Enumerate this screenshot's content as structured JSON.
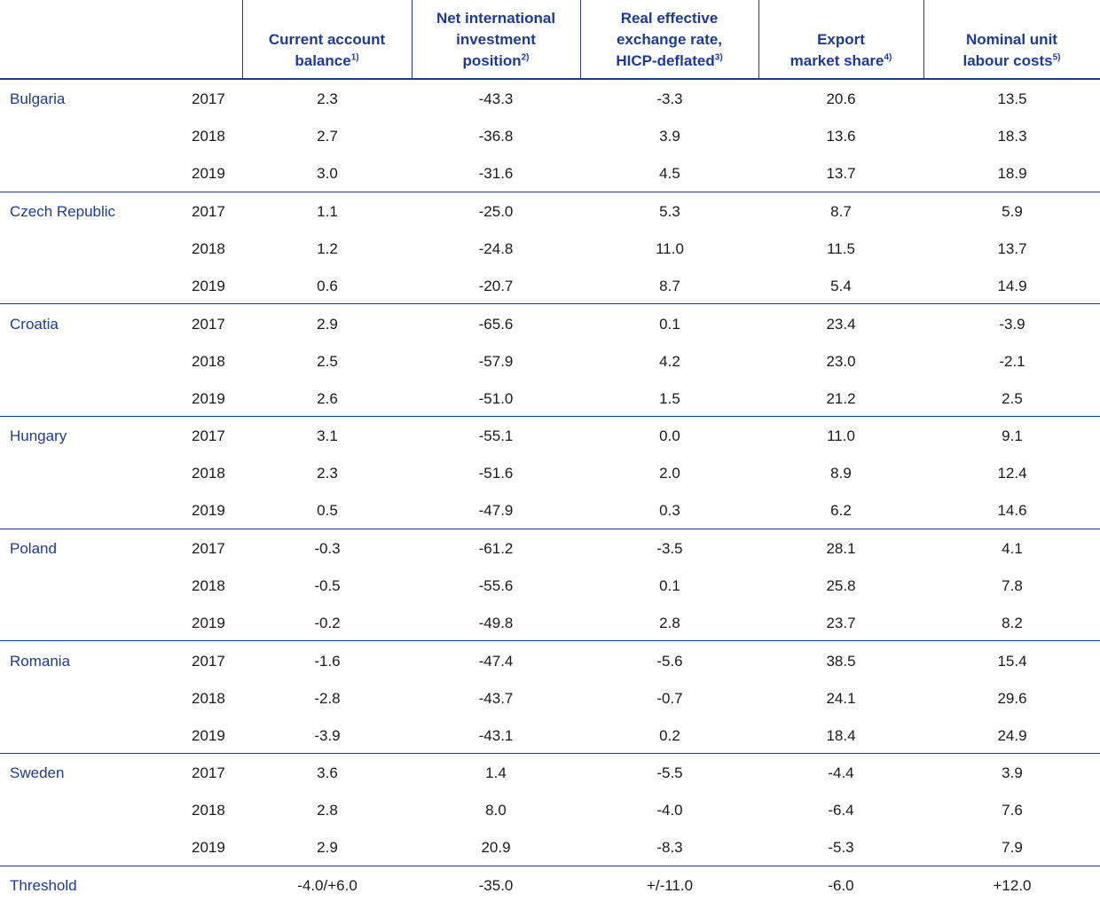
{
  "header": {
    "columns": [
      {
        "lines": [
          "Current account",
          "balance"
        ],
        "note": "1)"
      },
      {
        "lines": [
          "Net international",
          "investment",
          "position"
        ],
        "note": "2)"
      },
      {
        "lines": [
          "Real effective",
          "exchange rate,",
          "HICP-deflated"
        ],
        "note": "3)"
      },
      {
        "lines": [
          "Export",
          "market share"
        ],
        "note": "4)"
      },
      {
        "lines": [
          "Nominal unit",
          "labour costs"
        ],
        "note": "5)"
      }
    ]
  },
  "countries": [
    {
      "name": "Bulgaria",
      "rows": [
        {
          "year": "2017",
          "values": [
            "2.3",
            "-43.3",
            "-3.3",
            "20.6",
            "13.5"
          ]
        },
        {
          "year": "2018",
          "values": [
            "2.7",
            "-36.8",
            "3.9",
            "13.6",
            "18.3"
          ]
        },
        {
          "year": "2019",
          "values": [
            "3.0",
            "-31.6",
            "4.5",
            "13.7",
            "18.9"
          ]
        }
      ]
    },
    {
      "name": "Czech Republic",
      "rows": [
        {
          "year": "2017",
          "values": [
            "1.1",
            "-25.0",
            "5.3",
            "8.7",
            "5.9"
          ]
        },
        {
          "year": "2018",
          "values": [
            "1.2",
            "-24.8",
            "11.0",
            "11.5",
            "13.7"
          ]
        },
        {
          "year": "2019",
          "values": [
            "0.6",
            "-20.7",
            "8.7",
            "5.4",
            "14.9"
          ]
        }
      ]
    },
    {
      "name": "Croatia",
      "rows": [
        {
          "year": "2017",
          "values": [
            "2.9",
            "-65.6",
            "0.1",
            "23.4",
            "-3.9"
          ]
        },
        {
          "year": "2018",
          "values": [
            "2.5",
            "-57.9",
            "4.2",
            "23.0",
            "-2.1"
          ]
        },
        {
          "year": "2019",
          "values": [
            "2.6",
            "-51.0",
            "1.5",
            "21.2",
            "2.5"
          ]
        }
      ]
    },
    {
      "name": "Hungary",
      "rows": [
        {
          "year": "2017",
          "values": [
            "3.1",
            "-55.1",
            "0.0",
            "11.0",
            "9.1"
          ]
        },
        {
          "year": "2018",
          "values": [
            "2.3",
            "-51.6",
            "2.0",
            "8.9",
            "12.4"
          ]
        },
        {
          "year": "2019",
          "values": [
            "0.5",
            "-47.9",
            "0.3",
            "6.2",
            "14.6"
          ]
        }
      ]
    },
    {
      "name": "Poland",
      "rows": [
        {
          "year": "2017",
          "values": [
            "-0.3",
            "-61.2",
            "-3.5",
            "28.1",
            "4.1"
          ]
        },
        {
          "year": "2018",
          "values": [
            "-0.5",
            "-55.6",
            "0.1",
            "25.8",
            "7.8"
          ]
        },
        {
          "year": "2019",
          "values": [
            "-0.2",
            "-49.8",
            "2.8",
            "23.7",
            "8.2"
          ]
        }
      ]
    },
    {
      "name": "Romania",
      "rows": [
        {
          "year": "2017",
          "values": [
            "-1.6",
            "-47.4",
            "-5.6",
            "38.5",
            "15.4"
          ]
        },
        {
          "year": "2018",
          "values": [
            "-2.8",
            "-43.7",
            "-0.7",
            "24.1",
            "29.6"
          ]
        },
        {
          "year": "2019",
          "values": [
            "-3.9",
            "-43.1",
            "0.2",
            "18.4",
            "24.9"
          ]
        }
      ]
    },
    {
      "name": "Sweden",
      "rows": [
        {
          "year": "2017",
          "values": [
            "3.6",
            "1.4",
            "-5.5",
            "-4.4",
            "3.9"
          ]
        },
        {
          "year": "2018",
          "values": [
            "2.8",
            "8.0",
            "-4.0",
            "-6.4",
            "7.6"
          ]
        },
        {
          "year": "2019",
          "values": [
            "2.9",
            "20.9",
            "-8.3",
            "-5.3",
            "7.9"
          ]
        }
      ]
    }
  ],
  "threshold": {
    "label": "Threshold",
    "values": [
      "-4.0/+6.0",
      "-35.0",
      "+/-11.0",
      "-6.0",
      "+12.0"
    ]
  },
  "colors": {
    "accent": "#1f3a93",
    "text": "#1a1a1a"
  }
}
